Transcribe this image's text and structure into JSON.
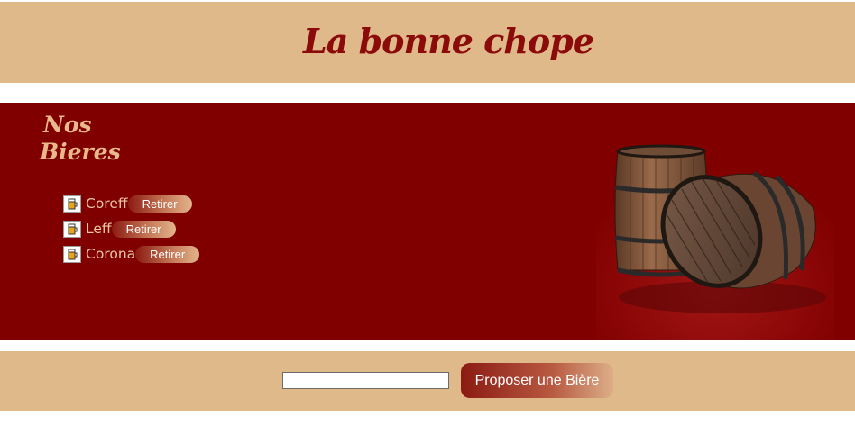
{
  "header": {
    "logo_text": "La bonne chope"
  },
  "section": {
    "title_line1": "Nos",
    "title_line2": "Bieres"
  },
  "beers": [
    {
      "name": "Coreff",
      "action_label": "Retirer",
      "icon": "beer-mug-icon"
    },
    {
      "name": "Leff",
      "action_label": "Retirer",
      "icon": "beer-mug-icon"
    },
    {
      "name": "Corona",
      "action_label": "Retirer",
      "icon": "beer-mug-icon"
    }
  ],
  "illustration": {
    "icon": "wooden-barrels-image"
  },
  "footer": {
    "input_value": "",
    "input_placeholder": "",
    "submit_label": "Proposer une Bière"
  },
  "colors": {
    "header_bg": "#dfb98a",
    "main_bg": "#800000",
    "logo_red": "#8b0a0a",
    "section_title": "#e9b98c",
    "beer_name": "#e9c7a4"
  }
}
